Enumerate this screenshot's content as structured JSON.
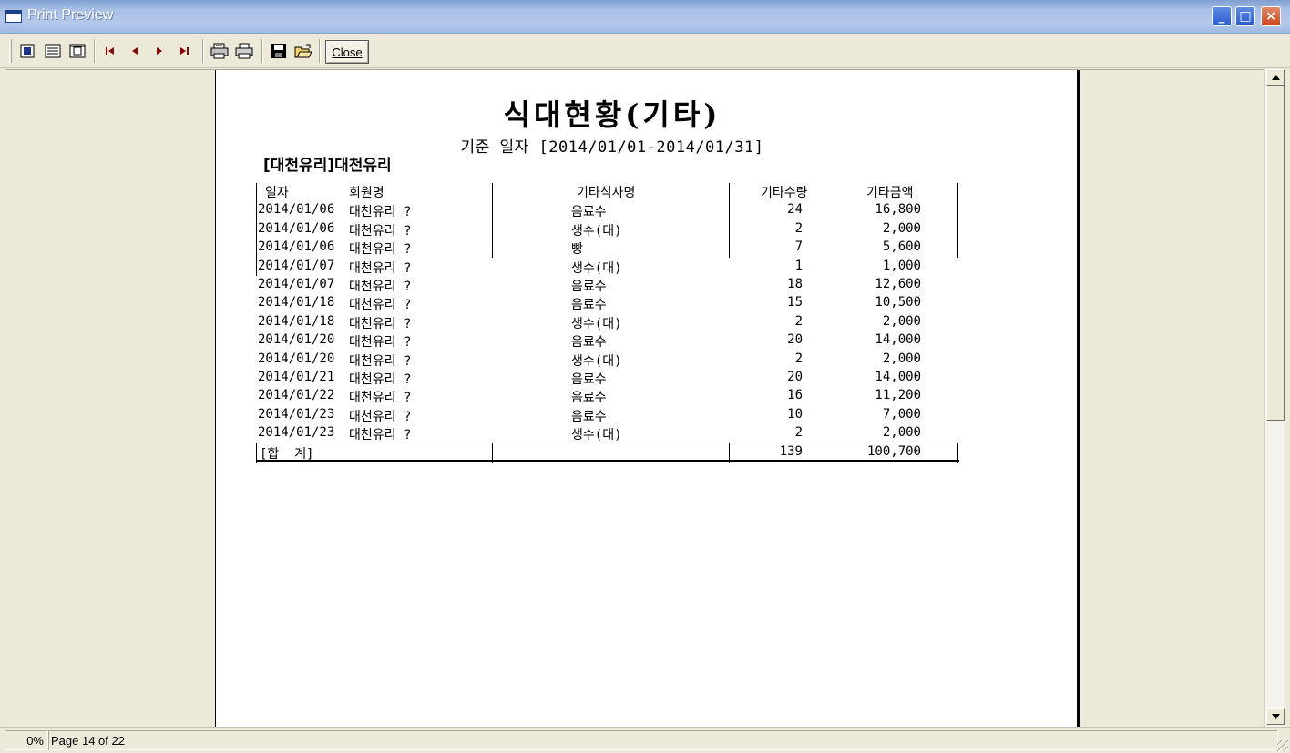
{
  "window": {
    "title": "Print Preview",
    "minimize": "_",
    "maximize": "□",
    "close": "×"
  },
  "toolbar": {
    "close_label": "Close",
    "icons": [
      "page-view-icon",
      "list-view-icon",
      "fit-view-icon",
      "first-page-icon",
      "prev-page-icon",
      "next-page-icon",
      "last-page-icon",
      "print-setup-icon",
      "print-icon",
      "save-icon",
      "open-icon"
    ]
  },
  "report": {
    "title": "식대현황(기타)",
    "date_range": "기준 일자 [2014/01/01-2014/01/31]",
    "member": "[대천유리]대천유리",
    "columns": {
      "date": "일자",
      "name": "회원명",
      "item": "기타식사명",
      "qty": "기타수량",
      "amount": "기타금액"
    },
    "rows": [
      {
        "date": "2014/01/06",
        "name": "대천유리 ?",
        "item": "음료수",
        "qty": "24",
        "amount": "16,800"
      },
      {
        "date": "2014/01/06",
        "name": "대천유리 ?",
        "item": "생수(대)",
        "qty": "2",
        "amount": "2,000"
      },
      {
        "date": "2014/01/06",
        "name": "대천유리 ?",
        "item": "빵",
        "qty": "7",
        "amount": "5,600"
      },
      {
        "date": "2014/01/07",
        "name": "대천유리 ?",
        "item": "생수(대)",
        "qty": "1",
        "amount": "1,000"
      },
      {
        "date": "2014/01/07",
        "name": "대천유리 ?",
        "item": "음료수",
        "qty": "18",
        "amount": "12,600"
      },
      {
        "date": "2014/01/18",
        "name": "대천유리 ?",
        "item": "음료수",
        "qty": "15",
        "amount": "10,500"
      },
      {
        "date": "2014/01/18",
        "name": "대천유리 ?",
        "item": "생수(대)",
        "qty": "2",
        "amount": "2,000"
      },
      {
        "date": "2014/01/20",
        "name": "대천유리 ?",
        "item": "음료수",
        "qty": "20",
        "amount": "14,000"
      },
      {
        "date": "2014/01/20",
        "name": "대천유리 ?",
        "item": "생수(대)",
        "qty": "2",
        "amount": "2,000"
      },
      {
        "date": "2014/01/21",
        "name": "대천유리 ?",
        "item": "음료수",
        "qty": "20",
        "amount": "14,000"
      },
      {
        "date": "2014/01/22",
        "name": "대천유리 ?",
        "item": "음료수",
        "qty": "16",
        "amount": "11,200"
      },
      {
        "date": "2014/01/23",
        "name": "대천유리 ?",
        "item": "음료수",
        "qty": "10",
        "amount": "7,000"
      },
      {
        "date": "2014/01/23",
        "name": "대천유리 ?",
        "item": "생수(대)",
        "qty": "2",
        "amount": "2,000"
      }
    ],
    "total": {
      "label": "[합  계]",
      "qty": "139",
      "amount": "100,700"
    }
  },
  "status": {
    "progress": "0%",
    "page": "Page 14 of 22"
  }
}
